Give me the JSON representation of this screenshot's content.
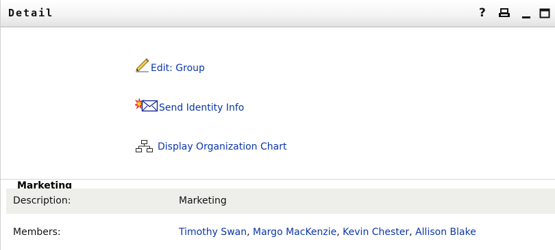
{
  "portlet": {
    "title": "Detail",
    "controls": {
      "help": "?",
      "icons": [
        "help-icon",
        "print-icon",
        "minimize-icon",
        "maximize-icon"
      ]
    }
  },
  "actions": [
    {
      "label": "Edit: Group",
      "icon": "pencil-icon"
    },
    {
      "label": "Send Identity Info",
      "icon": "envelope-icon"
    },
    {
      "label": "Display Organization Chart",
      "icon": "org-chart-icon"
    }
  ],
  "group": {
    "name": "Marketing"
  },
  "properties": {
    "description": {
      "label": "Description:",
      "value": "Marketing"
    },
    "members": {
      "label": "Members:",
      "values": [
        "Timothy Swan",
        "Margo MacKenzie",
        "Kevin Chester",
        "Allison Blake"
      ],
      "separator": ","
    }
  },
  "colors": {
    "link": "#0b36a8",
    "row_shade": "#eeeeea"
  }
}
